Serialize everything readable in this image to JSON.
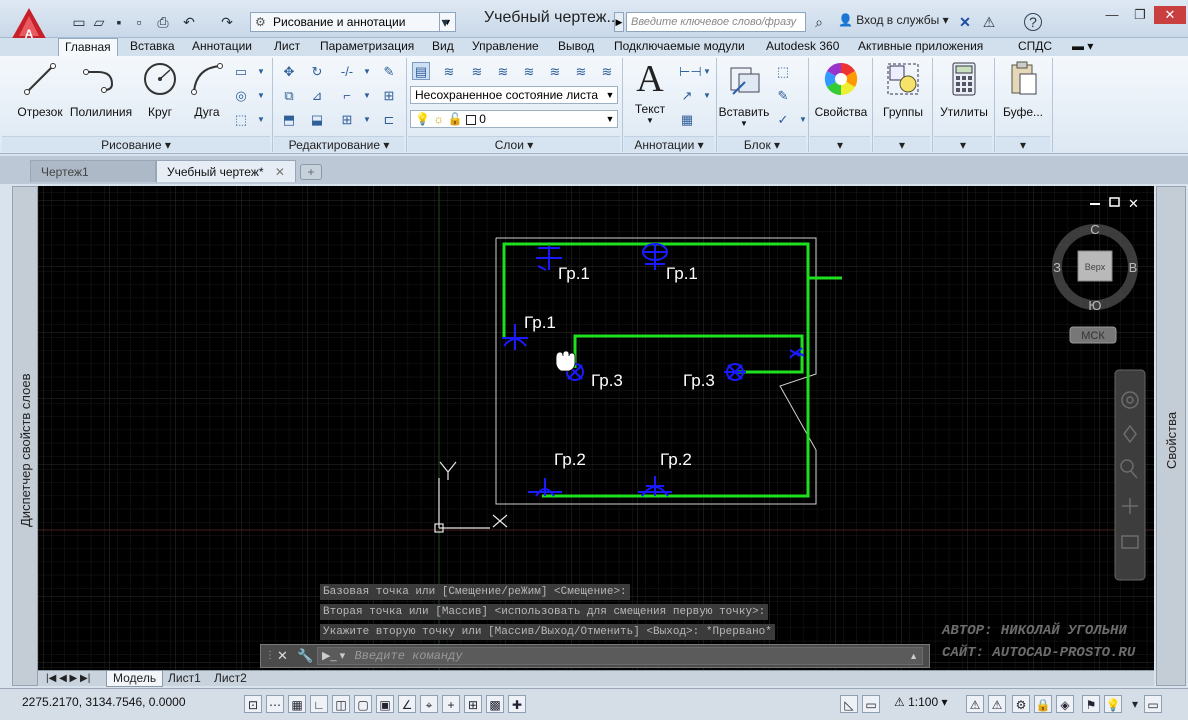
{
  "title_bar": {
    "workspace": "Рисование и аннотации",
    "document_title": "Учебный чертеж....",
    "search_placeholder": "Введите ключевое слово/фразу",
    "login_label": "Вход в службы"
  },
  "ribbon_tabs": [
    "Главная",
    "Вставка",
    "Аннотации",
    "Лист",
    "Параметризация",
    "Вид",
    "Управление",
    "Вывод",
    "Подключаемые модули",
    "Autodesk 360",
    "Активные приложения",
    "СПДС"
  ],
  "panels": {
    "draw": {
      "title": "Рисование",
      "tools": [
        "Отрезок",
        "Полилиния",
        "Круг",
        "Дуга"
      ]
    },
    "modify": {
      "title": "Редактирование"
    },
    "layers": {
      "title": "Слои",
      "layer_state": "Несохраненное состояние листа",
      "current_layer": "0"
    },
    "annotations": {
      "title": "Аннотации",
      "text_label": "Текст"
    },
    "block": {
      "title": "Блок",
      "insert_label": "Вставить"
    },
    "properties_label": "Свойства",
    "groups_label": "Группы",
    "utilities_label": "Утилиты",
    "clipboard_label": "Буфе..."
  },
  "file_tabs": [
    "Чертеж1",
    "Учебный чертеж*"
  ],
  "palettes": {
    "left": "Диспетчер свойств слоев",
    "right": "Свойства"
  },
  "viewcube": {
    "north": "С",
    "south": "Ю",
    "west": "З",
    "east": "В",
    "face": "Верх",
    "ucs": "МСК"
  },
  "drawing_labels": {
    "top_left": "Гр.1",
    "top_right": "Гр.1",
    "left": "Гр.1",
    "mid_left": "Гр.3",
    "mid_right": "Гр.3",
    "bottom_left": "Гр.2",
    "bottom_right": "Гр.2"
  },
  "command_history": [
    "Базовая точка или [Смещение/реЖим] <Смещение>:",
    "Вторая точка или [Массив] <использовать для смещения первую точку>:",
    "Укажите вторую точку или [Массив/Выход/Отменить] <Выход>: *Прервано*"
  ],
  "command_placeholder": "Введите команду",
  "watermark": {
    "line1": "АВТОР: НИКОЛАЙ УГОЛЬНИ",
    "line2": "САЙТ: AUTOCAD-PROSTO.RU"
  },
  "layout_tabs": [
    "Модель",
    "Лист1",
    "Лист2"
  ],
  "status_bar": {
    "coordinates": "2275.2170, 3134.7546, 0.0000",
    "scale": "1:100"
  },
  "axes": {
    "x": "X",
    "y": "Y"
  },
  "colors": {
    "green_lines": "#1ee01e",
    "blue_symbols": "#1a1aff",
    "grid_minor": "#1c1c1c",
    "grid_major": "#2a2a2a"
  }
}
